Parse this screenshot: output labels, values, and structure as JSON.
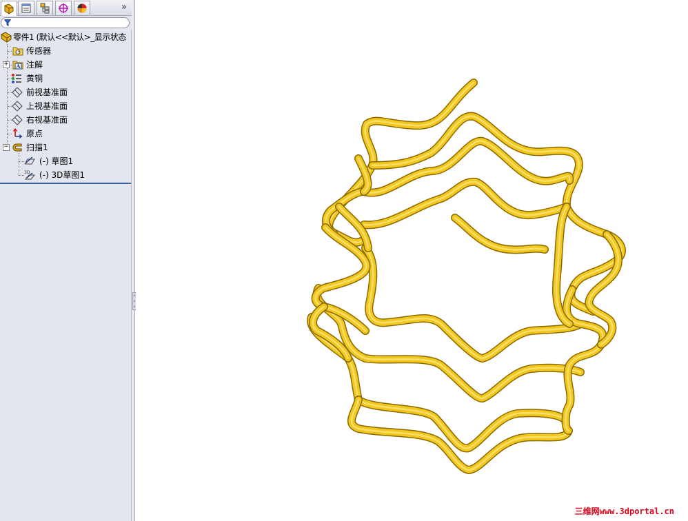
{
  "panel": {
    "tabs": [
      {
        "name": "featuremanager-tab",
        "icon": "feature-tree-icon"
      },
      {
        "name": "propertymanager-tab",
        "icon": "property-manager-icon"
      },
      {
        "name": "configurationmanager-tab",
        "icon": "configuration-manager-icon"
      },
      {
        "name": "dimxpert-tab",
        "icon": "target-icon"
      },
      {
        "name": "display-manager-tab",
        "icon": "color-wheel-icon"
      }
    ],
    "more_label": "»",
    "filter": {
      "placeholder": ""
    },
    "tree": {
      "root": "零件1  (默认<<默认>_显示状态",
      "items": [
        {
          "label": "传感器",
          "icon": "sensor-icon"
        },
        {
          "label": "注解",
          "icon": "annotation-icon",
          "expandable": true
        },
        {
          "label": "黄铜",
          "icon": "material-icon"
        },
        {
          "label": "前视基准面",
          "icon": "plane-icon"
        },
        {
          "label": "上视基准面",
          "icon": "plane-icon"
        },
        {
          "label": "右视基准面",
          "icon": "plane-icon"
        },
        {
          "label": "原点",
          "icon": "origin-icon"
        },
        {
          "label": "扫描1",
          "icon": "sweep-icon",
          "expanded": true
        },
        {
          "label": "(-) 草图1",
          "icon": "sketch-icon",
          "child": true
        },
        {
          "label": "(-) 3D草图1",
          "icon": "3d-sketch-icon",
          "child": true
        }
      ]
    }
  },
  "viewport": {
    "model_color": "#f2c81e",
    "model_shadow": "#8a6a00",
    "watermark": "三维网www.3dportal.cn"
  }
}
